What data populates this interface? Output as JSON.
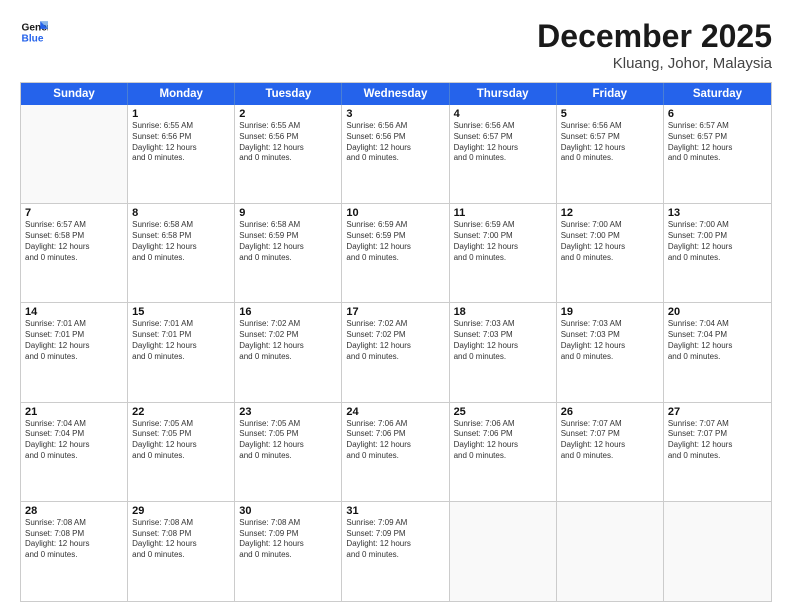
{
  "logo": {
    "line1": "General",
    "line2": "Blue"
  },
  "title": "December 2025",
  "location": "Kluang, Johor, Malaysia",
  "days_of_week": [
    "Sunday",
    "Monday",
    "Tuesday",
    "Wednesday",
    "Thursday",
    "Friday",
    "Saturday"
  ],
  "weeks": [
    [
      {
        "day": "",
        "info": ""
      },
      {
        "day": "1",
        "info": "Sunrise: 6:55 AM\nSunset: 6:56 PM\nDaylight: 12 hours\nand 0 minutes."
      },
      {
        "day": "2",
        "info": "Sunrise: 6:55 AM\nSunset: 6:56 PM\nDaylight: 12 hours\nand 0 minutes."
      },
      {
        "day": "3",
        "info": "Sunrise: 6:56 AM\nSunset: 6:56 PM\nDaylight: 12 hours\nand 0 minutes."
      },
      {
        "day": "4",
        "info": "Sunrise: 6:56 AM\nSunset: 6:57 PM\nDaylight: 12 hours\nand 0 minutes."
      },
      {
        "day": "5",
        "info": "Sunrise: 6:56 AM\nSunset: 6:57 PM\nDaylight: 12 hours\nand 0 minutes."
      },
      {
        "day": "6",
        "info": "Sunrise: 6:57 AM\nSunset: 6:57 PM\nDaylight: 12 hours\nand 0 minutes."
      }
    ],
    [
      {
        "day": "7",
        "info": "Sunrise: 6:57 AM\nSunset: 6:58 PM\nDaylight: 12 hours\nand 0 minutes."
      },
      {
        "day": "8",
        "info": "Sunrise: 6:58 AM\nSunset: 6:58 PM\nDaylight: 12 hours\nand 0 minutes."
      },
      {
        "day": "9",
        "info": "Sunrise: 6:58 AM\nSunset: 6:59 PM\nDaylight: 12 hours\nand 0 minutes."
      },
      {
        "day": "10",
        "info": "Sunrise: 6:59 AM\nSunset: 6:59 PM\nDaylight: 12 hours\nand 0 minutes."
      },
      {
        "day": "11",
        "info": "Sunrise: 6:59 AM\nSunset: 7:00 PM\nDaylight: 12 hours\nand 0 minutes."
      },
      {
        "day": "12",
        "info": "Sunrise: 7:00 AM\nSunset: 7:00 PM\nDaylight: 12 hours\nand 0 minutes."
      },
      {
        "day": "13",
        "info": "Sunrise: 7:00 AM\nSunset: 7:00 PM\nDaylight: 12 hours\nand 0 minutes."
      }
    ],
    [
      {
        "day": "14",
        "info": "Sunrise: 7:01 AM\nSunset: 7:01 PM\nDaylight: 12 hours\nand 0 minutes."
      },
      {
        "day": "15",
        "info": "Sunrise: 7:01 AM\nSunset: 7:01 PM\nDaylight: 12 hours\nand 0 minutes."
      },
      {
        "day": "16",
        "info": "Sunrise: 7:02 AM\nSunset: 7:02 PM\nDaylight: 12 hours\nand 0 minutes."
      },
      {
        "day": "17",
        "info": "Sunrise: 7:02 AM\nSunset: 7:02 PM\nDaylight: 12 hours\nand 0 minutes."
      },
      {
        "day": "18",
        "info": "Sunrise: 7:03 AM\nSunset: 7:03 PM\nDaylight: 12 hours\nand 0 minutes."
      },
      {
        "day": "19",
        "info": "Sunrise: 7:03 AM\nSunset: 7:03 PM\nDaylight: 12 hours\nand 0 minutes."
      },
      {
        "day": "20",
        "info": "Sunrise: 7:04 AM\nSunset: 7:04 PM\nDaylight: 12 hours\nand 0 minutes."
      }
    ],
    [
      {
        "day": "21",
        "info": "Sunrise: 7:04 AM\nSunset: 7:04 PM\nDaylight: 12 hours\nand 0 minutes."
      },
      {
        "day": "22",
        "info": "Sunrise: 7:05 AM\nSunset: 7:05 PM\nDaylight: 12 hours\nand 0 minutes."
      },
      {
        "day": "23",
        "info": "Sunrise: 7:05 AM\nSunset: 7:05 PM\nDaylight: 12 hours\nand 0 minutes."
      },
      {
        "day": "24",
        "info": "Sunrise: 7:06 AM\nSunset: 7:06 PM\nDaylight: 12 hours\nand 0 minutes."
      },
      {
        "day": "25",
        "info": "Sunrise: 7:06 AM\nSunset: 7:06 PM\nDaylight: 12 hours\nand 0 minutes."
      },
      {
        "day": "26",
        "info": "Sunrise: 7:07 AM\nSunset: 7:07 PM\nDaylight: 12 hours\nand 0 minutes."
      },
      {
        "day": "27",
        "info": "Sunrise: 7:07 AM\nSunset: 7:07 PM\nDaylight: 12 hours\nand 0 minutes."
      }
    ],
    [
      {
        "day": "28",
        "info": "Sunrise: 7:08 AM\nSunset: 7:08 PM\nDaylight: 12 hours\nand 0 minutes."
      },
      {
        "day": "29",
        "info": "Sunrise: 7:08 AM\nSunset: 7:08 PM\nDaylight: 12 hours\nand 0 minutes."
      },
      {
        "day": "30",
        "info": "Sunrise: 7:08 AM\nSunset: 7:09 PM\nDaylight: 12 hours\nand 0 minutes."
      },
      {
        "day": "31",
        "info": "Sunrise: 7:09 AM\nSunset: 7:09 PM\nDaylight: 12 hours\nand 0 minutes."
      },
      {
        "day": "",
        "info": ""
      },
      {
        "day": "",
        "info": ""
      },
      {
        "day": "",
        "info": ""
      }
    ]
  ]
}
